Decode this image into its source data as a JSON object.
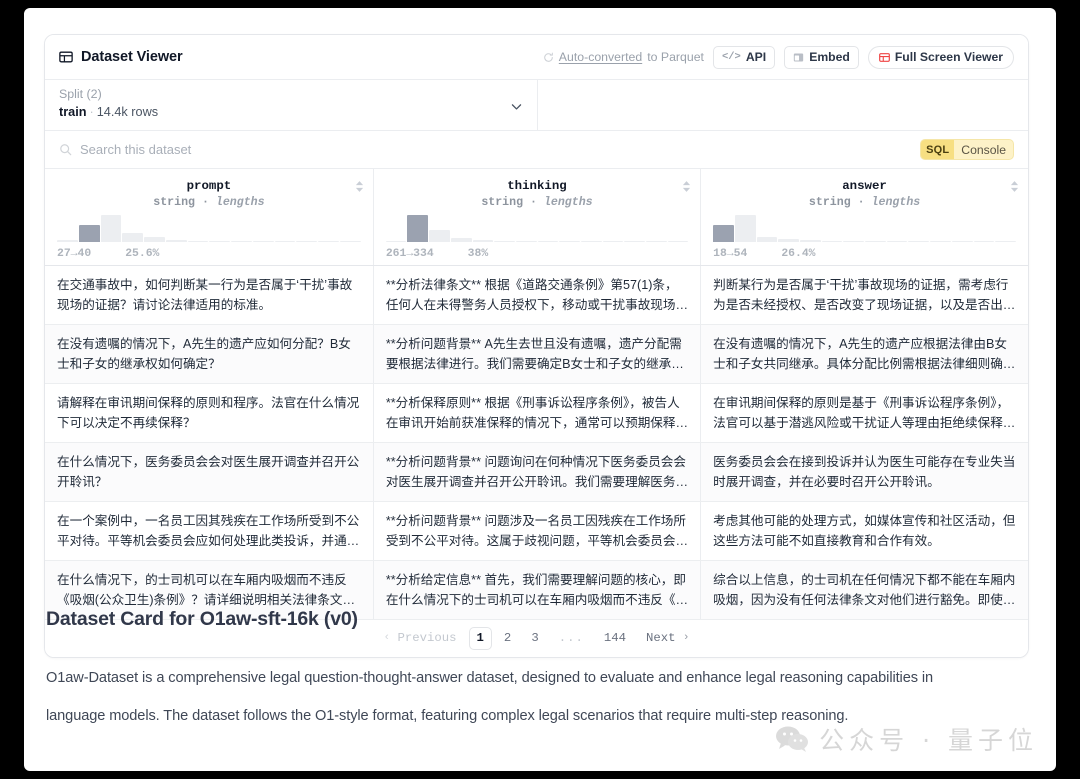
{
  "header": {
    "title": "Dataset Viewer",
    "title_icon": "grid-icon",
    "auto_converted_prefix": "Auto-converted",
    "auto_converted_link": "Auto-converted",
    "auto_converted_suffix": " to Parquet",
    "refresh_icon": "refresh-icon",
    "api_label": "API",
    "api_icon": "</>",
    "embed_label": "Embed",
    "embed_icon": "window-icon",
    "fullscreen_label": "Full Screen Viewer",
    "fullscreen_icon": "grid-icon"
  },
  "split": {
    "label": "Split (2)",
    "value_name": "train",
    "separator": "·",
    "value_rows": "14.4k rows",
    "chevron_icon": "chevron-down-icon"
  },
  "search": {
    "placeholder": "Search this dataset",
    "value": "",
    "icon": "search-icon",
    "sql_tag": "SQL",
    "sql_label": "Console"
  },
  "columns": [
    {
      "name": "prompt",
      "type": "string",
      "type_suffix": "lengths",
      "range": "27→40",
      "percent": "25.6%",
      "sort_icon": "sort-icon",
      "histogram": [
        6,
        62,
        100,
        34,
        17,
        8,
        5,
        3,
        2,
        2,
        1,
        1,
        1,
        1
      ],
      "highlight_index": 1
    },
    {
      "name": "thinking",
      "type": "string",
      "type_suffix": "lengths",
      "range": "261→334",
      "percent": "38%",
      "sort_icon": "sort-icon",
      "histogram": [
        4,
        100,
        46,
        16,
        8,
        4,
        2,
        2,
        1,
        1,
        1,
        1,
        1,
        1
      ],
      "highlight_index": 1
    },
    {
      "name": "answer",
      "type": "string",
      "type_suffix": "lengths",
      "range": "18→54",
      "percent": "26.4%",
      "sort_icon": "sort-icon",
      "histogram": [
        40,
        62,
        12,
        6,
        4,
        3,
        2,
        1,
        1,
        1,
        1,
        1,
        1,
        1
      ],
      "highlight_index": 0
    }
  ],
  "rows": [
    {
      "prompt": "在交通事故中，如何判断某一行为是否属于‘干扰’事故现场的证据？请讨论法律适用的标准。",
      "thinking": "**分析法律条文**  根据《道路交通条例》第57(1)条，任何人在未得警务人员授权下，移动或干扰事故现场的车辆…",
      "answer": "判断某行为是否属于‘干扰’事故现场的证据，需考虑行为是否未经授权、是否改变了现场证据，以及是否出于紧急…"
    },
    {
      "prompt": "在没有遗嘱的情况下，A先生的遗产应如何分配？B女士和子女的继承权如何确定？",
      "thinking": "**分析问题背景**  A先生去世且没有遗嘱，遗产分配需要根据法律进行。我们需要确定B女士和子女的继承权。 **…",
      "answer": "在没有遗嘱的情况下，A先生的遗产应根据法律由B女士和子女共同继承。具体分配比例需根据法律细则确定。"
    },
    {
      "prompt": "请解释在审讯期间保释的原则和程序。法官在什么情况下可以决定不再续保释？",
      "thinking": "**分析保释原则**  根据《刑事诉讼程序条例》，被告人在审讯开始前获准保释的情况下，通常可以预期保释会在整…",
      "answer": "在审讯期间保释的原则是基于《刑事诉讼程序条例》，法官可以基于潜逃风险或干扰证人等理由拒绝续保释。程序上…"
    },
    {
      "prompt": "在什么情况下，医务委员会会对医生展开调查并召开公开聆讯？",
      "thinking": "**分析问题背景**  问题询问在何种情况下医务委员会会对医生展开调查并召开公开聆讯。我们需要理解医务委员会…",
      "answer": "医务委员会会在接到投诉并认为医生可能存在专业失当时展开调查，并在必要时召开公开聆讯。"
    },
    {
      "prompt": "在一个案例中，一名员工因其残疾在工作场所受到不公平对待。平等机会委员会应如何处理此类投诉，并通过哪些方…",
      "thinking": "**分析问题背景**  问题涉及一名员工因残疾在工作场所受到不公平对待。这属于歧视问题，平等机会委员会需要处…",
      "answer": "考虑其他可能的处理方式，如媒体宣传和社区活动，但这些方法可能不如直接教育和合作有效。"
    },
    {
      "prompt": "在什么情况下，的士司机可以在车厢内吸烟而不违反《吸烟(公众卫生)条例》？请详细说明相关法律条文和例外情…",
      "thinking": "**分析给定信息**  首先，我们需要理解问题的核心，即在什么情况下的士司机可以在车厢内吸烟而不违反《吸烟(…",
      "answer": "综合以上信息，的士司机在任何情况下都不能在车厢内吸烟，因为没有任何法律条文对他们进行豁免。即使没有乘…"
    }
  ],
  "pagination": {
    "previous_label": "Previous",
    "previous_arrow": "‹",
    "pages": [
      "1",
      "2",
      "3"
    ],
    "ellipsis": "...",
    "last_page": "144",
    "next_label": "Next",
    "next_arrow": "›",
    "active_page": "1"
  },
  "dataset_card": {
    "title": "Dataset Card for O1aw-sft-16k (v0)",
    "paragraph": "O1aw-Dataset is a comprehensive legal question-thought-answer dataset, designed to evaluate and enhance legal reasoning capabilities in language models. The dataset follows the O1-style format, featuring complex legal scenarios that require multi-step reasoning."
  },
  "watermark": {
    "text": "公众号 · 量子位",
    "icon": "wechat-icon"
  },
  "colors": {
    "accent_red": "#ef4444",
    "sql_yellow": "#f7df82",
    "border": "#e5e7eb",
    "text_primary": "#111827",
    "text_muted": "#9aa1ab"
  }
}
